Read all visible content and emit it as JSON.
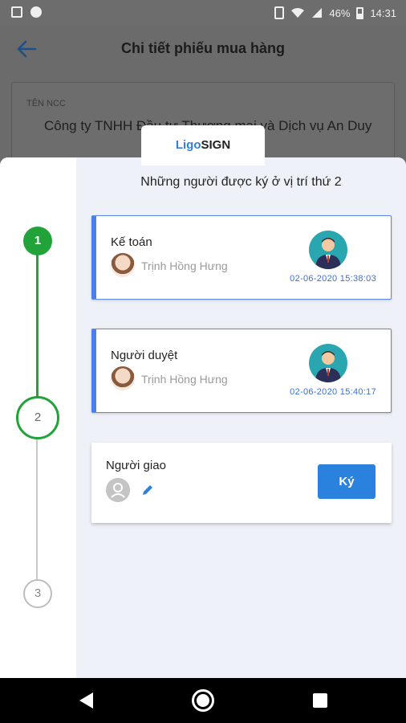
{
  "status_bar": {
    "battery": "46%",
    "time": "14:31"
  },
  "app_bar": {
    "title": "Chi tiết phiếu mua hàng"
  },
  "supplier": {
    "label": "TÊN NCC",
    "name": "Công ty TNHH Đầu tư Thương mại và Dịch vụ An Duy"
  },
  "tab": {
    "brand_prefix": "Ligo",
    "brand_suffix": "SIGN"
  },
  "sheet": {
    "title": "Những người được ký ở vị trí thứ 2"
  },
  "steps": [
    "1",
    "2",
    "3"
  ],
  "cards": [
    {
      "role": "Kế toán",
      "person": "Trịnh Hồng Hưng",
      "timestamp": "02-06-2020 15:38:03"
    },
    {
      "role": "Người duyệt",
      "person": "Trịnh Hồng Hưng",
      "timestamp": "02-06-2020 15:40:17"
    },
    {
      "role": "Người giao",
      "button": "Ký"
    }
  ],
  "colors": {
    "accent": "#2b82de",
    "step_done": "#22a33a",
    "card_border": "#4a7fe8",
    "overlay": "#6b6b6b"
  }
}
